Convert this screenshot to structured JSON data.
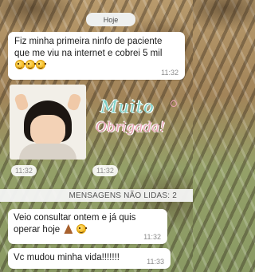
{
  "chat": {
    "date_chip": "Hoje",
    "messages": [
      {
        "text": "Fiz minha primeira ninfo de paciente que me viu na internet e cobrei 5 mil",
        "time": "11:32"
      },
      {
        "image_subject": "child-photo",
        "time": "11:32"
      },
      {
        "sticker_line1": "Muito",
        "sticker_line2": "Obrigada!",
        "time": "11:32"
      },
      {
        "text": "Veio consultar ontem e já quis operar hoje",
        "time": "11:32"
      },
      {
        "text": "Vc mudou minha vida!!!!!!!",
        "time": "11:33"
      }
    ],
    "unread_divider": "MENSAGENS NÃO LIDAS: 2"
  },
  "icons": {
    "emoji": "grinning-face-icon",
    "pray": "folded-hands-icon",
    "heart": "heart-outline-icon"
  },
  "colors": {
    "bubble": "#ffffff",
    "sticker_teal": "#7fd0c6",
    "sticker_pink": "#e9a2b4"
  }
}
